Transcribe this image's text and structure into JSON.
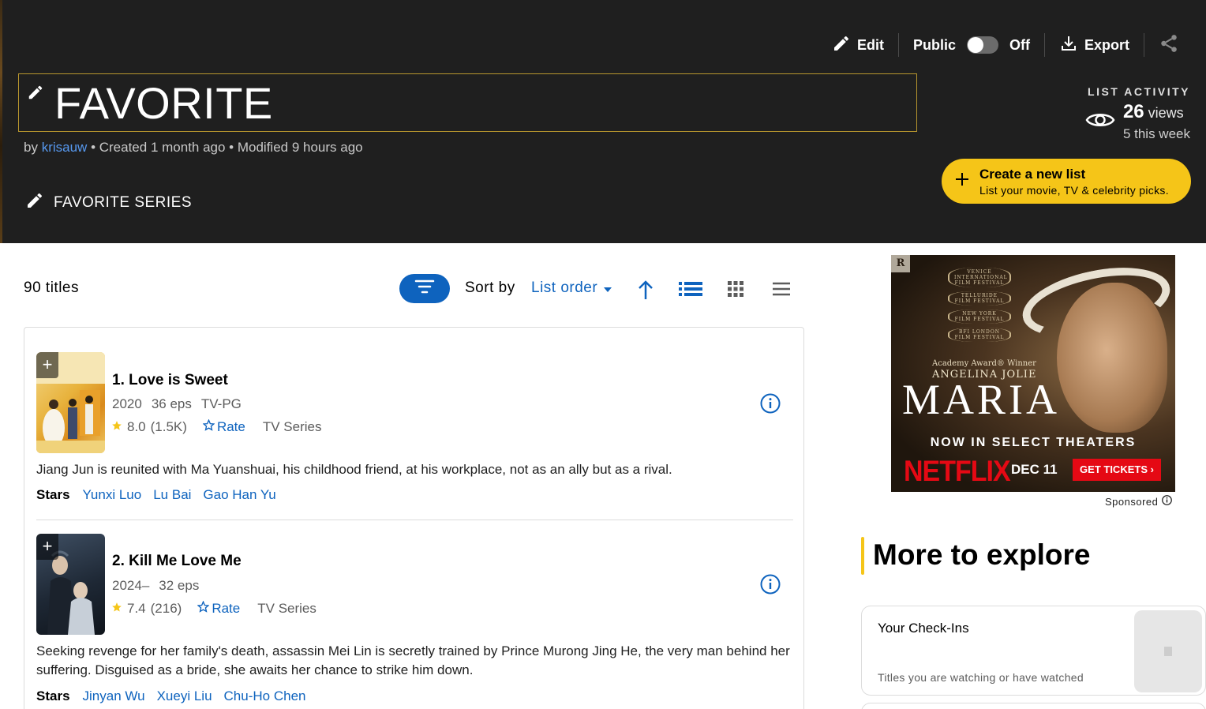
{
  "toolbar": {
    "edit_label": "Edit",
    "public_label": "Public",
    "toggle_state": "Off",
    "export_label": "Export"
  },
  "list": {
    "title": "FAVORITE",
    "by_prefix": "by",
    "author": "krisauw",
    "created": "• Created 1 month ago • Modified 9 hours ago",
    "description": "FAVORITE SERIES"
  },
  "activity": {
    "label": "LIST ACTIVITY",
    "views_count": "26",
    "views_suffix": "views",
    "this_week": "5 this week"
  },
  "create": {
    "title": "Create a new list",
    "subtitle": "List your movie, TV & celebrity picks."
  },
  "controls": {
    "count": "90 titles",
    "sort_by_label": "Sort by",
    "sort_value": "List order"
  },
  "items": [
    {
      "title": "1. Love is Sweet",
      "meta": [
        "2020",
        "36 eps",
        "TV-PG"
      ],
      "rating": "8.0",
      "votes": "(1.5K)",
      "rate_label": "Rate",
      "type": "TV Series",
      "plot": "Jiang Jun is reunited with Ma Yuanshuai, his childhood friend, at his workplace, not as an ally but as a rival.",
      "stars_label": "Stars",
      "stars": [
        "Yunxi Luo",
        "Lu Bai",
        "Gao Han Yu"
      ]
    },
    {
      "title": "2. Kill Me Love Me",
      "meta": [
        "2024–",
        "32 eps"
      ],
      "rating": "7.4",
      "votes": "(216)",
      "rate_label": "Rate",
      "type": "TV Series",
      "plot": "Seeking revenge for her family's death, assassin Mei Lin is secretly trained by Prince Murong Jing He, the very man behind her suffering. Disguised as a bride, she awaits her chance to strike him down.",
      "stars_label": "Stars",
      "stars": [
        "Jinyan Wu",
        "Xueyi Liu",
        "Chu-Ho Chen"
      ]
    }
  ],
  "ad": {
    "rating_badge": "R",
    "festivals": [
      "VENICE INTERNATIONAL FILM FESTIVAL",
      "TELLURIDE FILM FESTIVAL",
      "NEW YORK FILM FESTIVAL",
      "BFI LONDON FILM FESTIVAL"
    ],
    "award_line": "Academy Award® Winner",
    "actor": "ANGELINA JOLIE",
    "film": "MARIA",
    "now_playing": "NOW IN SELECT THEATERS",
    "brand": "NETFLIX",
    "date": "DEC 11",
    "cta": "GET TICKETS ›",
    "sponsored": "Sponsored"
  },
  "explore": {
    "title": "More to explore",
    "card_title": "Your Check-Ins",
    "card_subtitle": "Titles you are watching or have watched"
  },
  "colors": {
    "header_bg": "#1f1f1f",
    "accent_yellow": "#f5c518",
    "link_blue": "#0e63be",
    "author_blue": "#5799ef"
  }
}
